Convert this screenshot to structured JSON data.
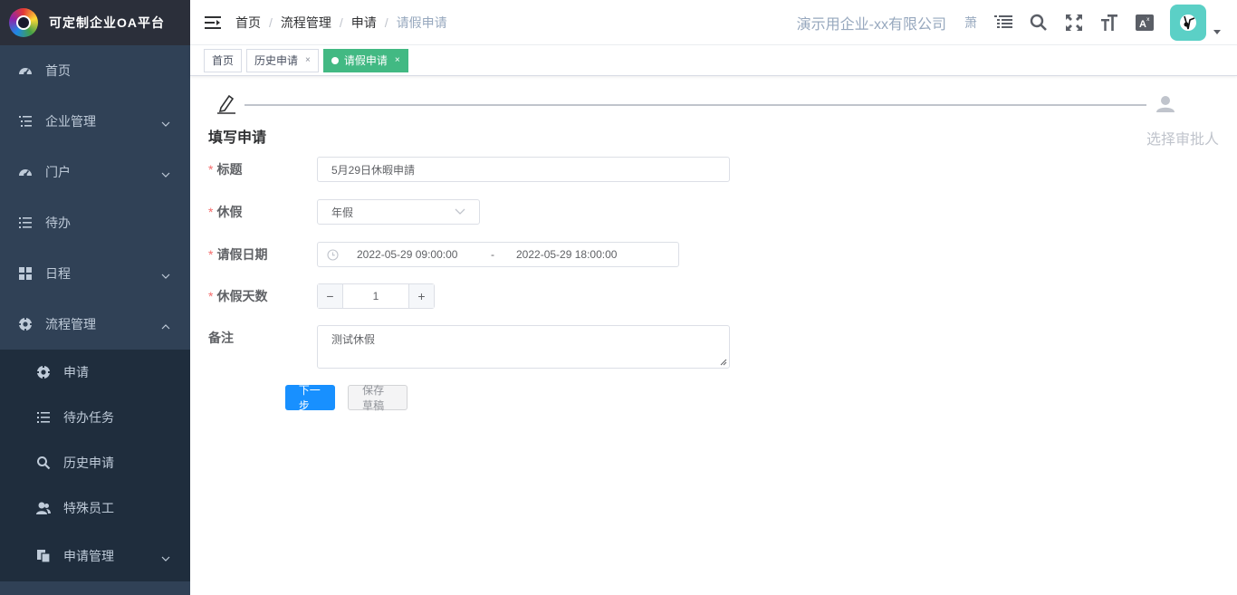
{
  "brand": {
    "title": "可定制企业OA平台"
  },
  "sidebar": {
    "items": [
      {
        "label": "首页"
      },
      {
        "label": "企业管理"
      },
      {
        "label": "门户"
      },
      {
        "label": "待办"
      },
      {
        "label": "日程"
      },
      {
        "label": "流程管理"
      }
    ],
    "subitems": [
      {
        "label": "申请"
      },
      {
        "label": "待办任务"
      },
      {
        "label": "历史申请"
      },
      {
        "label": "特殊员工"
      },
      {
        "label": "申请管理"
      }
    ]
  },
  "breadcrumb": {
    "items": [
      "首页",
      "流程管理",
      "申请"
    ],
    "current": "请假申请",
    "sep": "/"
  },
  "header": {
    "company": "演示用企业-xx有限公司",
    "lang_char": "萧"
  },
  "tags": [
    {
      "label": "首页"
    },
    {
      "label": "历史申请",
      "close": "×"
    },
    {
      "label": "请假申请",
      "close": "×"
    }
  ],
  "steps": {
    "step1": "填写申请",
    "step2": "选择审批人"
  },
  "form": {
    "title_label": "标题",
    "title_value": "5月29日休暇申請",
    "leave_label": "休假",
    "leave_value": "年假",
    "date_label": "请假日期",
    "date_start": "2022-05-29 09:00:00",
    "date_sep": "-",
    "date_end": "2022-05-29 18:00:00",
    "days_label": "休假天数",
    "days_minus": "−",
    "days_value": "1",
    "days_plus": "+",
    "remark_label": "备注",
    "remark_value": "测试休假",
    "required_mark": "*",
    "next_button": "下一步",
    "save_button": "保存草稿"
  },
  "colors": {
    "sidebar_bg": "#304156",
    "primary": "#1890ff",
    "tag_active": "#42b983",
    "required": "#f56c6c"
  }
}
